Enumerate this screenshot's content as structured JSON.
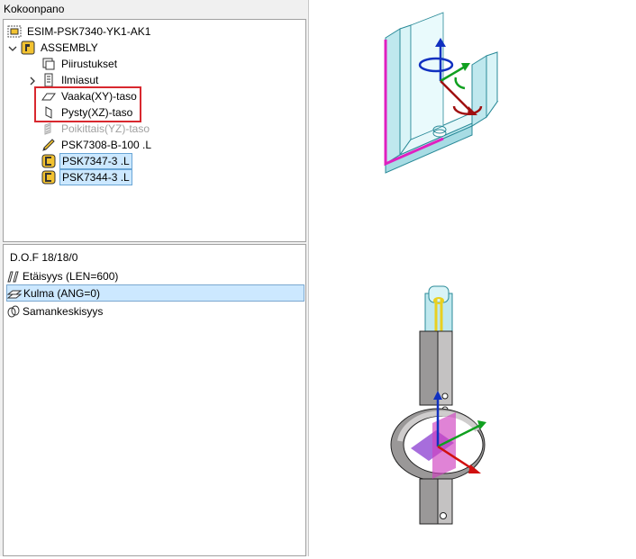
{
  "panel": {
    "title": "Kokoonpano"
  },
  "tree": {
    "root": "ESIM-PSK7340-YK1-AK1",
    "assembly": "ASSEMBLY",
    "drawings": "Piirustukset",
    "views": "Ilmiasut",
    "plane_xy": "Vaaka(XY)-taso",
    "plane_xz": "Pysty(XZ)-taso",
    "plane_yz": "Poikittais(YZ)-taso",
    "part_b100": "PSK7308-B-100 .L",
    "part_7347": "PSK7347-3 .L",
    "part_7344": "PSK7344-3 .L"
  },
  "dof": {
    "label": "D.O.F  18/18/0"
  },
  "constraints": [
    {
      "label": "Etäisyys (LEN=600)"
    },
    {
      "label": "Kulma (ANG=0)"
    },
    {
      "label": "Samankeskisyys"
    }
  ],
  "colors": {
    "highlight": "#d8282f",
    "selection": "#cce8ff",
    "axis_x": "#d01010",
    "axis_y": "#10a020",
    "axis_z": "#1030c0",
    "edge_magenta": "#e020c0"
  }
}
